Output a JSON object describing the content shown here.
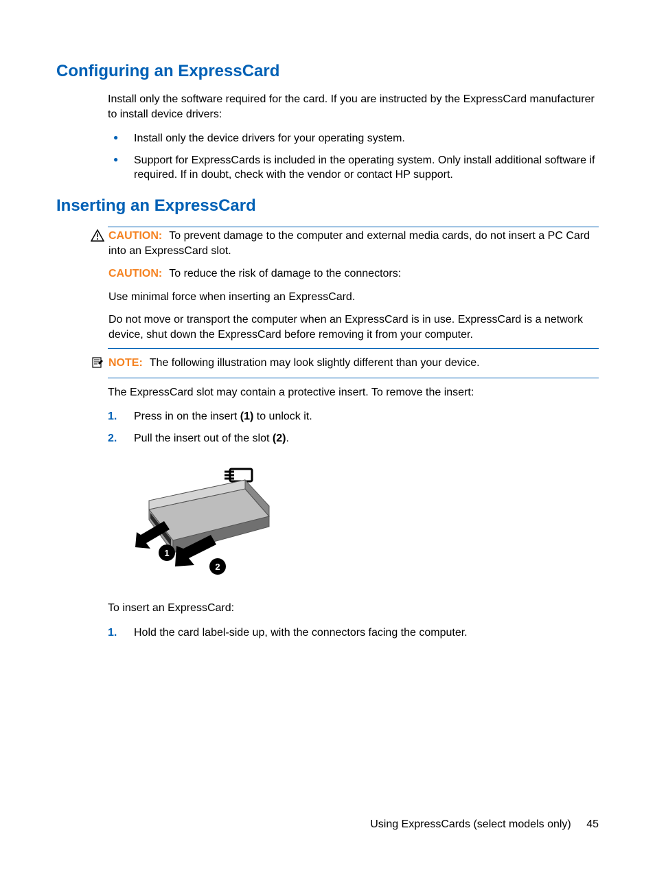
{
  "section1": {
    "heading": "Configuring an ExpressCard",
    "intro": "Install only the software required for the card. If you are instructed by the ExpressCard manufacturer to install device drivers:",
    "bullets": [
      "Install only the device drivers for your operating system.",
      "Support for ExpressCards is included in the operating system. Only install additional software if required. If in doubt, check with the vendor or contact HP support."
    ]
  },
  "section2": {
    "heading": "Inserting an ExpressCard",
    "caution1": {
      "label": "CAUTION:",
      "text": "To prevent damage to the computer and external media cards, do not insert a PC Card into an ExpressCard slot."
    },
    "caution2": {
      "label": "CAUTION:",
      "text": "To reduce the risk of damage to the connectors:"
    },
    "warn1": "Use minimal force when inserting an ExpressCard.",
    "warn2": "Do not move or transport the computer when an ExpressCard is in use. ExpressCard is a network device, shut down the ExpressCard before removing it from your computer.",
    "note": {
      "label": "NOTE:",
      "text": "The following illustration may look slightly different than your device."
    },
    "after_note": "The ExpressCard slot may contain a protective insert. To remove the insert:",
    "steps_remove": [
      {
        "num": "1.",
        "pre": "Press in on the insert ",
        "bold": "(1)",
        "post": " to unlock it."
      },
      {
        "num": "2.",
        "pre": "Pull the insert out of the slot ",
        "bold": "(2)",
        "post": "."
      }
    ],
    "insert_intro": "To insert an ExpressCard:",
    "steps_insert": [
      {
        "num": "1.",
        "text": "Hold the card label-side up, with the connectors facing the computer."
      }
    ]
  },
  "footer": {
    "text": "Using ExpressCards (select models only)",
    "page": "45"
  }
}
